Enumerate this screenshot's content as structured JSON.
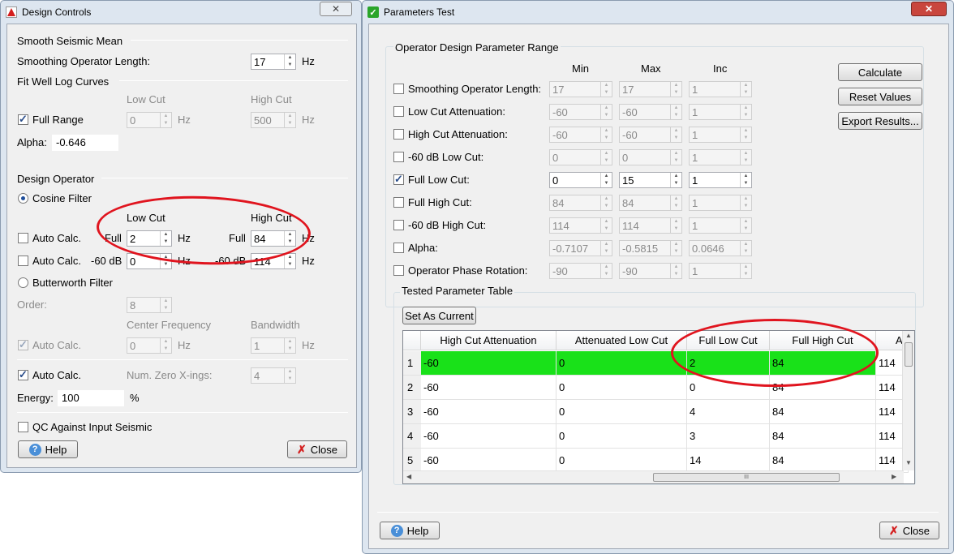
{
  "design_controls": {
    "title": "Design Controls",
    "close_label": "✕",
    "smooth_seismic_mean": "Smooth Seismic Mean",
    "smoothing_operator_length_label": "Smoothing Operator Length:",
    "smoothing_operator_length_value": "17",
    "hz": "Hz",
    "fit_well_log_curves": "Fit Well Log Curves",
    "low_cut": "Low Cut",
    "high_cut": "High Cut",
    "full_range_label": "Full Range",
    "full_range_low_value": "0",
    "full_range_high_value": "500",
    "alpha_label": "Alpha:",
    "alpha_value": "-0.646",
    "design_operator": "Design Operator",
    "cosine_filter": "Cosine Filter",
    "auto_calc": "Auto Calc.",
    "full": "Full",
    "cos_full_low_value": "2",
    "cos_full_high_value": "84",
    "minus60db": "-60 dB",
    "cos_60_low_value": "0",
    "cos_60_high_value": "114",
    "butterworth_filter": "Butterworth Filter",
    "order_label": "Order:",
    "order_value": "8",
    "center_frequency": "Center Frequency",
    "bandwidth": "Bandwidth",
    "center_value": "0",
    "bandwidth_value": "1",
    "num_zero_xings_label": "Num. Zero X-ings:",
    "num_zero_xings_value": "4",
    "energy_label": "Energy:",
    "energy_value": "100",
    "percent": "%",
    "qc_label": "QC Against Input Seismic",
    "help_label": "Help",
    "close_button_label": "Close"
  },
  "parameters_test": {
    "title": "Parameters Test",
    "close_label": "✕",
    "range_group_title": "Operator Design Parameter Range",
    "col_min": "Min",
    "col_max": "Max",
    "col_inc": "Inc",
    "params": [
      {
        "label": "Smoothing Operator Length:",
        "min": "17",
        "max": "17",
        "inc": "1",
        "checked": false
      },
      {
        "label": "Low Cut Attenuation:",
        "min": "-60",
        "max": "-60",
        "inc": "1",
        "checked": false
      },
      {
        "label": "High Cut Attenuation:",
        "min": "-60",
        "max": "-60",
        "inc": "1",
        "checked": false
      },
      {
        "label": "-60 dB Low Cut:",
        "min": "0",
        "max": "0",
        "inc": "1",
        "checked": false
      },
      {
        "label": "Full Low Cut:",
        "min": "0",
        "max": "15",
        "inc": "1",
        "checked": true
      },
      {
        "label": "Full High Cut:",
        "min": "84",
        "max": "84",
        "inc": "1",
        "checked": false
      },
      {
        "label": "-60 dB High Cut:",
        "min": "114",
        "max": "114",
        "inc": "1",
        "checked": false
      },
      {
        "label": "Alpha:",
        "min": "-0.7107",
        "max": "-0.5815",
        "inc": "0.0646",
        "checked": false
      },
      {
        "label": "Operator Phase Rotation:",
        "min": "-90",
        "max": "-90",
        "inc": "1",
        "checked": false
      }
    ],
    "calculate_label": "Calculate",
    "reset_label": "Reset Values",
    "export_label": "Export Results...",
    "table_group_title": "Tested Parameter Table",
    "set_as_current_label": "Set As Current",
    "table_headers": [
      "High Cut Attenuation",
      "Attenuated Low Cut",
      "Full Low Cut",
      "Full High Cut",
      "A"
    ],
    "rows": [
      {
        "num": "1",
        "cells": [
          "-60",
          "0",
          "2",
          "84",
          "114"
        ]
      },
      {
        "num": "2",
        "cells": [
          "-60",
          "0",
          "0",
          "84",
          "114"
        ]
      },
      {
        "num": "3",
        "cells": [
          "-60",
          "0",
          "4",
          "84",
          "114"
        ]
      },
      {
        "num": "4",
        "cells": [
          "-60",
          "0",
          "3",
          "84",
          "114"
        ]
      },
      {
        "num": "5",
        "cells": [
          "-60",
          "0",
          "14",
          "84",
          "114"
        ]
      }
    ],
    "scroll_grip": "III",
    "help_label": "Help",
    "close_button_label": "Close"
  },
  "colors": {
    "selected_row": "#19e119",
    "annotation": "#e0141e"
  }
}
